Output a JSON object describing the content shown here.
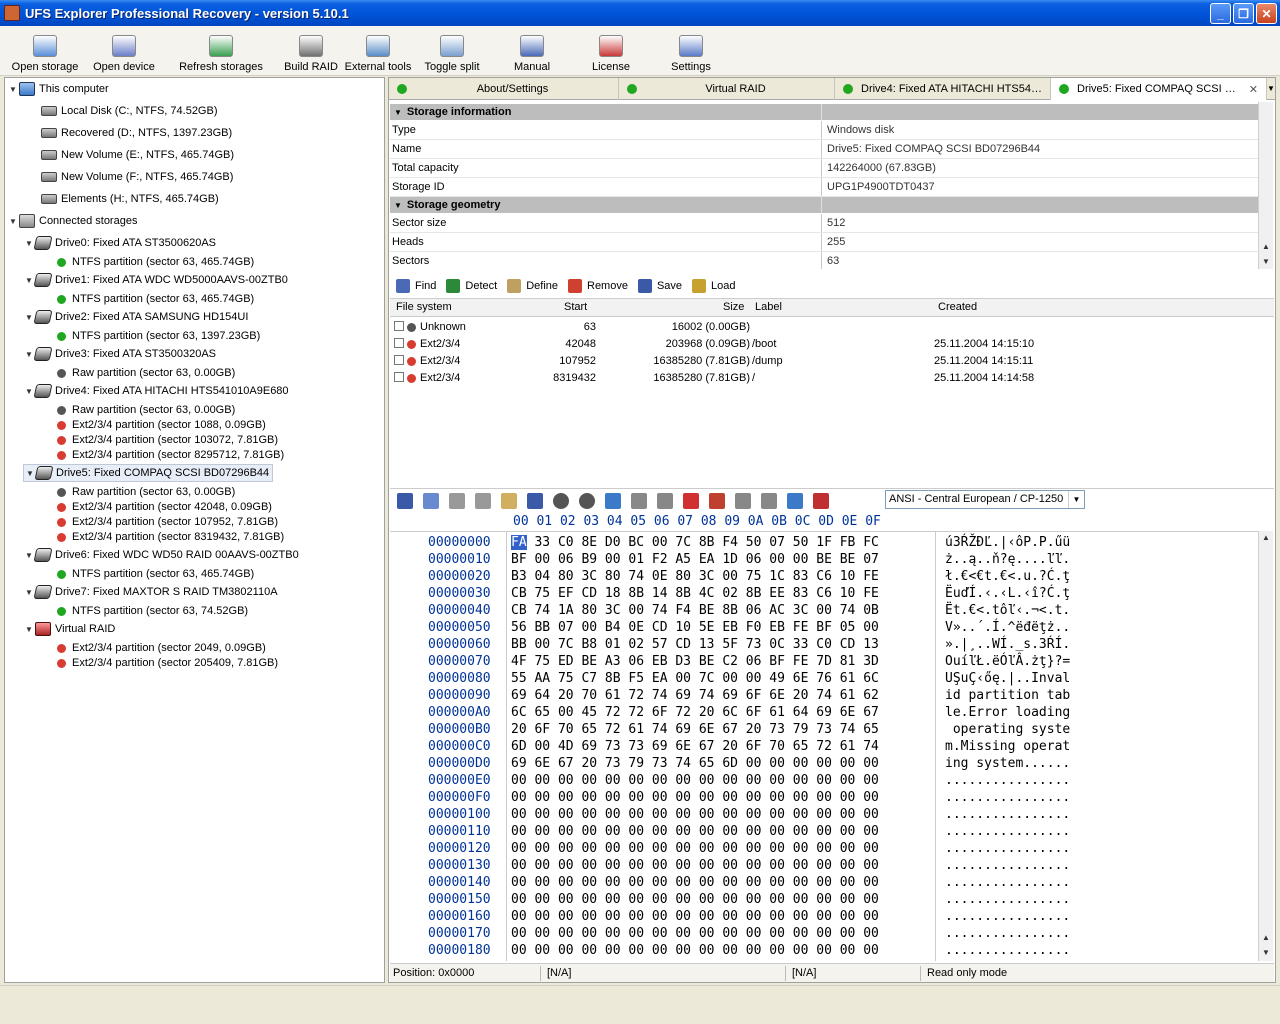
{
  "window": {
    "title": "UFS Explorer Professional Recovery - version 5.10.1"
  },
  "toolbar": [
    {
      "label": "Open storage",
      "icon": "open-storage-icon"
    },
    {
      "label": "Open device",
      "icon": "open-device-icon"
    },
    {
      "label": "Refresh storages",
      "icon": "refresh-icon"
    },
    {
      "label": "Build RAID",
      "icon": "raid-icon"
    },
    {
      "label": "External tools",
      "icon": "tools-icon"
    },
    {
      "label": "Toggle split",
      "icon": "split-icon"
    },
    {
      "label": "Manual",
      "icon": "manual-icon"
    },
    {
      "label": "License",
      "icon": "license-icon"
    },
    {
      "label": "Settings",
      "icon": "settings-icon"
    }
  ],
  "tree": {
    "this_computer": "This computer",
    "volumes": [
      "Local Disk (C:, NTFS, 74.52GB)",
      "Recovered (D:, NTFS, 1397.23GB)",
      "New Volume (E:, NTFS, 465.74GB)",
      "New Volume (F:, NTFS, 465.74GB)",
      "Elements (H:, NTFS, 465.74GB)"
    ],
    "connected_storages": "Connected storages",
    "drives": [
      {
        "label": "Drive0: Fixed ATA ST3500620AS",
        "parts": [
          {
            "label": "NTFS partition (sector 63, 465.74GB)",
            "status": "green"
          }
        ]
      },
      {
        "label": "Drive1: Fixed ATA WDC WD5000AAVS-00ZTB0",
        "parts": [
          {
            "label": "NTFS partition (sector 63, 465.74GB)",
            "status": "green"
          }
        ]
      },
      {
        "label": "Drive2: Fixed ATA SAMSUNG HD154UI",
        "parts": [
          {
            "label": "NTFS partition (sector 63, 1397.23GB)",
            "status": "green"
          }
        ]
      },
      {
        "label": "Drive3: Fixed ATA ST3500320AS",
        "parts": [
          {
            "label": "Raw partition (sector 63, 0.00GB)",
            "status": "gray"
          }
        ]
      },
      {
        "label": "Drive4: Fixed ATA HITACHI HTS541010A9E680",
        "parts": [
          {
            "label": "Raw partition (sector 63, 0.00GB)",
            "status": "gray"
          },
          {
            "label": "Ext2/3/4 partition (sector 1088, 0.09GB)",
            "status": "red"
          },
          {
            "label": "Ext2/3/4 partition (sector 103072, 7.81GB)",
            "status": "red"
          },
          {
            "label": "Ext2/3/4 partition (sector 8295712, 7.81GB)",
            "status": "red"
          }
        ]
      },
      {
        "label": "Drive5: Fixed COMPAQ SCSI BD07296B44",
        "selected": true,
        "parts": [
          {
            "label": "Raw partition (sector 63, 0.00GB)",
            "status": "gray"
          },
          {
            "label": "Ext2/3/4 partition (sector 42048, 0.09GB)",
            "status": "red"
          },
          {
            "label": "Ext2/3/4 partition (sector 107952, 7.81GB)",
            "status": "red"
          },
          {
            "label": "Ext2/3/4 partition (sector 8319432, 7.81GB)",
            "status": "red"
          }
        ]
      },
      {
        "label": "Drive6: Fixed WDC WD50 RAID 00AAVS-00ZTB0",
        "parts": [
          {
            "label": "NTFS partition (sector 63, 465.74GB)",
            "status": "green"
          }
        ]
      },
      {
        "label": "Drive7: Fixed MAXTOR S RAID TM3802110A",
        "parts": [
          {
            "label": "NTFS partition (sector 63, 74.52GB)",
            "status": "green"
          }
        ]
      },
      {
        "label": "Virtual RAID",
        "raid": true,
        "parts": [
          {
            "label": "Ext2/3/4 partition (sector 2049, 0.09GB)",
            "status": "red"
          },
          {
            "label": "Ext2/3/4 partition (sector 205409, 7.81GB)",
            "status": "red"
          }
        ]
      }
    ]
  },
  "tabs": [
    {
      "label": "About/Settings"
    },
    {
      "label": "Virtual RAID"
    },
    {
      "label": "Drive4: Fixed ATA HITACHI HTS541..."
    },
    {
      "label": "Drive5: Fixed COMPAQ SCSI BD...",
      "active": true
    }
  ],
  "props": {
    "group1": "Storage information",
    "info": [
      {
        "k": "Type",
        "v": "Windows disk"
      },
      {
        "k": "Name",
        "v": "Drive5: Fixed COMPAQ SCSI BD07296B44"
      },
      {
        "k": "Total capacity",
        "v": "142264000 (67.83GB)"
      },
      {
        "k": "Storage ID",
        "v": "UPG1P4900TDT0437"
      }
    ],
    "group2": "Storage geometry",
    "geometry": [
      {
        "k": "Sector size",
        "v": "512"
      },
      {
        "k": "Heads",
        "v": "255"
      },
      {
        "k": "Sectors",
        "v": "63"
      }
    ]
  },
  "partition_tools": [
    "Find",
    "Detect",
    "Define",
    "Remove",
    "Save",
    "Load"
  ],
  "partition_table": {
    "headers": {
      "fs": "File system",
      "start": "Start",
      "size": "Size",
      "label": "Label",
      "created": "Created"
    },
    "rows": [
      {
        "fs": "Unknown",
        "status": "gray",
        "start": "63",
        "size": "16002 (0.00GB)",
        "label": "",
        "created": ""
      },
      {
        "fs": "Ext2/3/4",
        "status": "red",
        "start": "42048",
        "size": "203968 (0.09GB)",
        "label": "/boot",
        "created": "25.11.2004 14:15:10"
      },
      {
        "fs": "Ext2/3/4",
        "status": "red",
        "start": "107952",
        "size": "16385280 (7.81GB)",
        "label": "/dump",
        "created": "25.11.2004 14:15:11"
      },
      {
        "fs": "Ext2/3/4",
        "status": "red",
        "start": "8319432",
        "size": "16385280 (7.81GB)",
        "label": "/",
        "created": "25.11.2004 14:14:58"
      }
    ]
  },
  "encoding": "ANSI - Central European / CP-1250",
  "hex_header": "00 01 02 03 04 05 06 07 08 09 0A 0B 0C 0D 0E 0F",
  "hex_rows": [
    {
      "off": "00000000",
      "bytes": "33 C0 8E D0 BC 00 7C 8B F4 50 07 50 1F FB FC",
      "first": "FA",
      "ascii": "ú3ŔŽĐĽ.|‹ôP.P.űü"
    },
    {
      "off": "00000010",
      "bytes": "BF 00 06 B9 00 01 F2 A5 EA 1D 06 00 00 BE BE 07",
      "ascii": "ż..ą..ň?ę....ľľ."
    },
    {
      "off": "00000020",
      "bytes": "B3 04 80 3C 80 74 0E 80 3C 00 75 1C 83 C6 10 FE",
      "ascii": "ł.€<€t.€<.u.?Ć.ţ"
    },
    {
      "off": "00000030",
      "bytes": "CB 75 EF CD 18 8B 14 8B 4C 02 8B EE 83 C6 10 FE",
      "ascii": "ËuďÍ.‹.‹L.‹î?Ć.ţ"
    },
    {
      "off": "00000040",
      "bytes": "CB 74 1A 80 3C 00 74 F4 BE 8B 06 AC 3C 00 74 0B",
      "ascii": "Ët.€<.tôľ‹.¬<.t."
    },
    {
      "off": "00000050",
      "bytes": "56 BB 07 00 B4 0E CD 10 5E EB F0 EB FE BF 05 00",
      "ascii": "V»..´.Í.^ëđëţż.."
    },
    {
      "off": "00000060",
      "bytes": "BB 00 7C B8 01 02 57 CD 13 5F 73 0C 33 C0 CD 13",
      "ascii": "».|¸..WÍ._s.3ŔÍ."
    },
    {
      "off": "00000070",
      "bytes": "4F 75 ED BE A3 06 EB D3 BE C2 06 BF FE 7D 81 3D",
      "ascii": "OuíľŁ.ëÓľÂ.żţ}?="
    },
    {
      "off": "00000080",
      "bytes": "55 AA 75 C7 8B F5 EA 00 7C 00 00 49 6E 76 61 6C",
      "ascii": "UŞuÇ‹őę.|..Inval"
    },
    {
      "off": "00000090",
      "bytes": "69 64 20 70 61 72 74 69 74 69 6F 6E 20 74 61 62",
      "ascii": "id partition tab"
    },
    {
      "off": "000000A0",
      "bytes": "6C 65 00 45 72 72 6F 72 20 6C 6F 61 64 69 6E 67",
      "ascii": "le.Error loading"
    },
    {
      "off": "000000B0",
      "bytes": "20 6F 70 65 72 61 74 69 6E 67 20 73 79 73 74 65",
      "ascii": " operating syste"
    },
    {
      "off": "000000C0",
      "bytes": "6D 00 4D 69 73 73 69 6E 67 20 6F 70 65 72 61 74",
      "ascii": "m.Missing operat"
    },
    {
      "off": "000000D0",
      "bytes": "69 6E 67 20 73 79 73 74 65 6D 00 00 00 00 00 00",
      "ascii": "ing system......"
    },
    {
      "off": "000000E0",
      "bytes": "00 00 00 00 00 00 00 00 00 00 00 00 00 00 00 00",
      "ascii": "................"
    },
    {
      "off": "000000F0",
      "bytes": "00 00 00 00 00 00 00 00 00 00 00 00 00 00 00 00",
      "ascii": "................"
    },
    {
      "off": "00000100",
      "bytes": "00 00 00 00 00 00 00 00 00 00 00 00 00 00 00 00",
      "ascii": "................"
    },
    {
      "off": "00000110",
      "bytes": "00 00 00 00 00 00 00 00 00 00 00 00 00 00 00 00",
      "ascii": "................"
    },
    {
      "off": "00000120",
      "bytes": "00 00 00 00 00 00 00 00 00 00 00 00 00 00 00 00",
      "ascii": "................"
    },
    {
      "off": "00000130",
      "bytes": "00 00 00 00 00 00 00 00 00 00 00 00 00 00 00 00",
      "ascii": "................"
    },
    {
      "off": "00000140",
      "bytes": "00 00 00 00 00 00 00 00 00 00 00 00 00 00 00 00",
      "ascii": "................"
    },
    {
      "off": "00000150",
      "bytes": "00 00 00 00 00 00 00 00 00 00 00 00 00 00 00 00",
      "ascii": "................"
    },
    {
      "off": "00000160",
      "bytes": "00 00 00 00 00 00 00 00 00 00 00 00 00 00 00 00",
      "ascii": "................"
    },
    {
      "off": "00000170",
      "bytes": "00 00 00 00 00 00 00 00 00 00 00 00 00 00 00 00",
      "ascii": "................"
    },
    {
      "off": "00000180",
      "bytes": "00 00 00 00 00 00 00 00 00 00 00 00 00 00 00 00",
      "ascii": "................"
    }
  ],
  "status": {
    "position": "Position: 0x0000",
    "na1": "[N/A]",
    "na2": "[N/A]",
    "mode": "Read only mode"
  }
}
